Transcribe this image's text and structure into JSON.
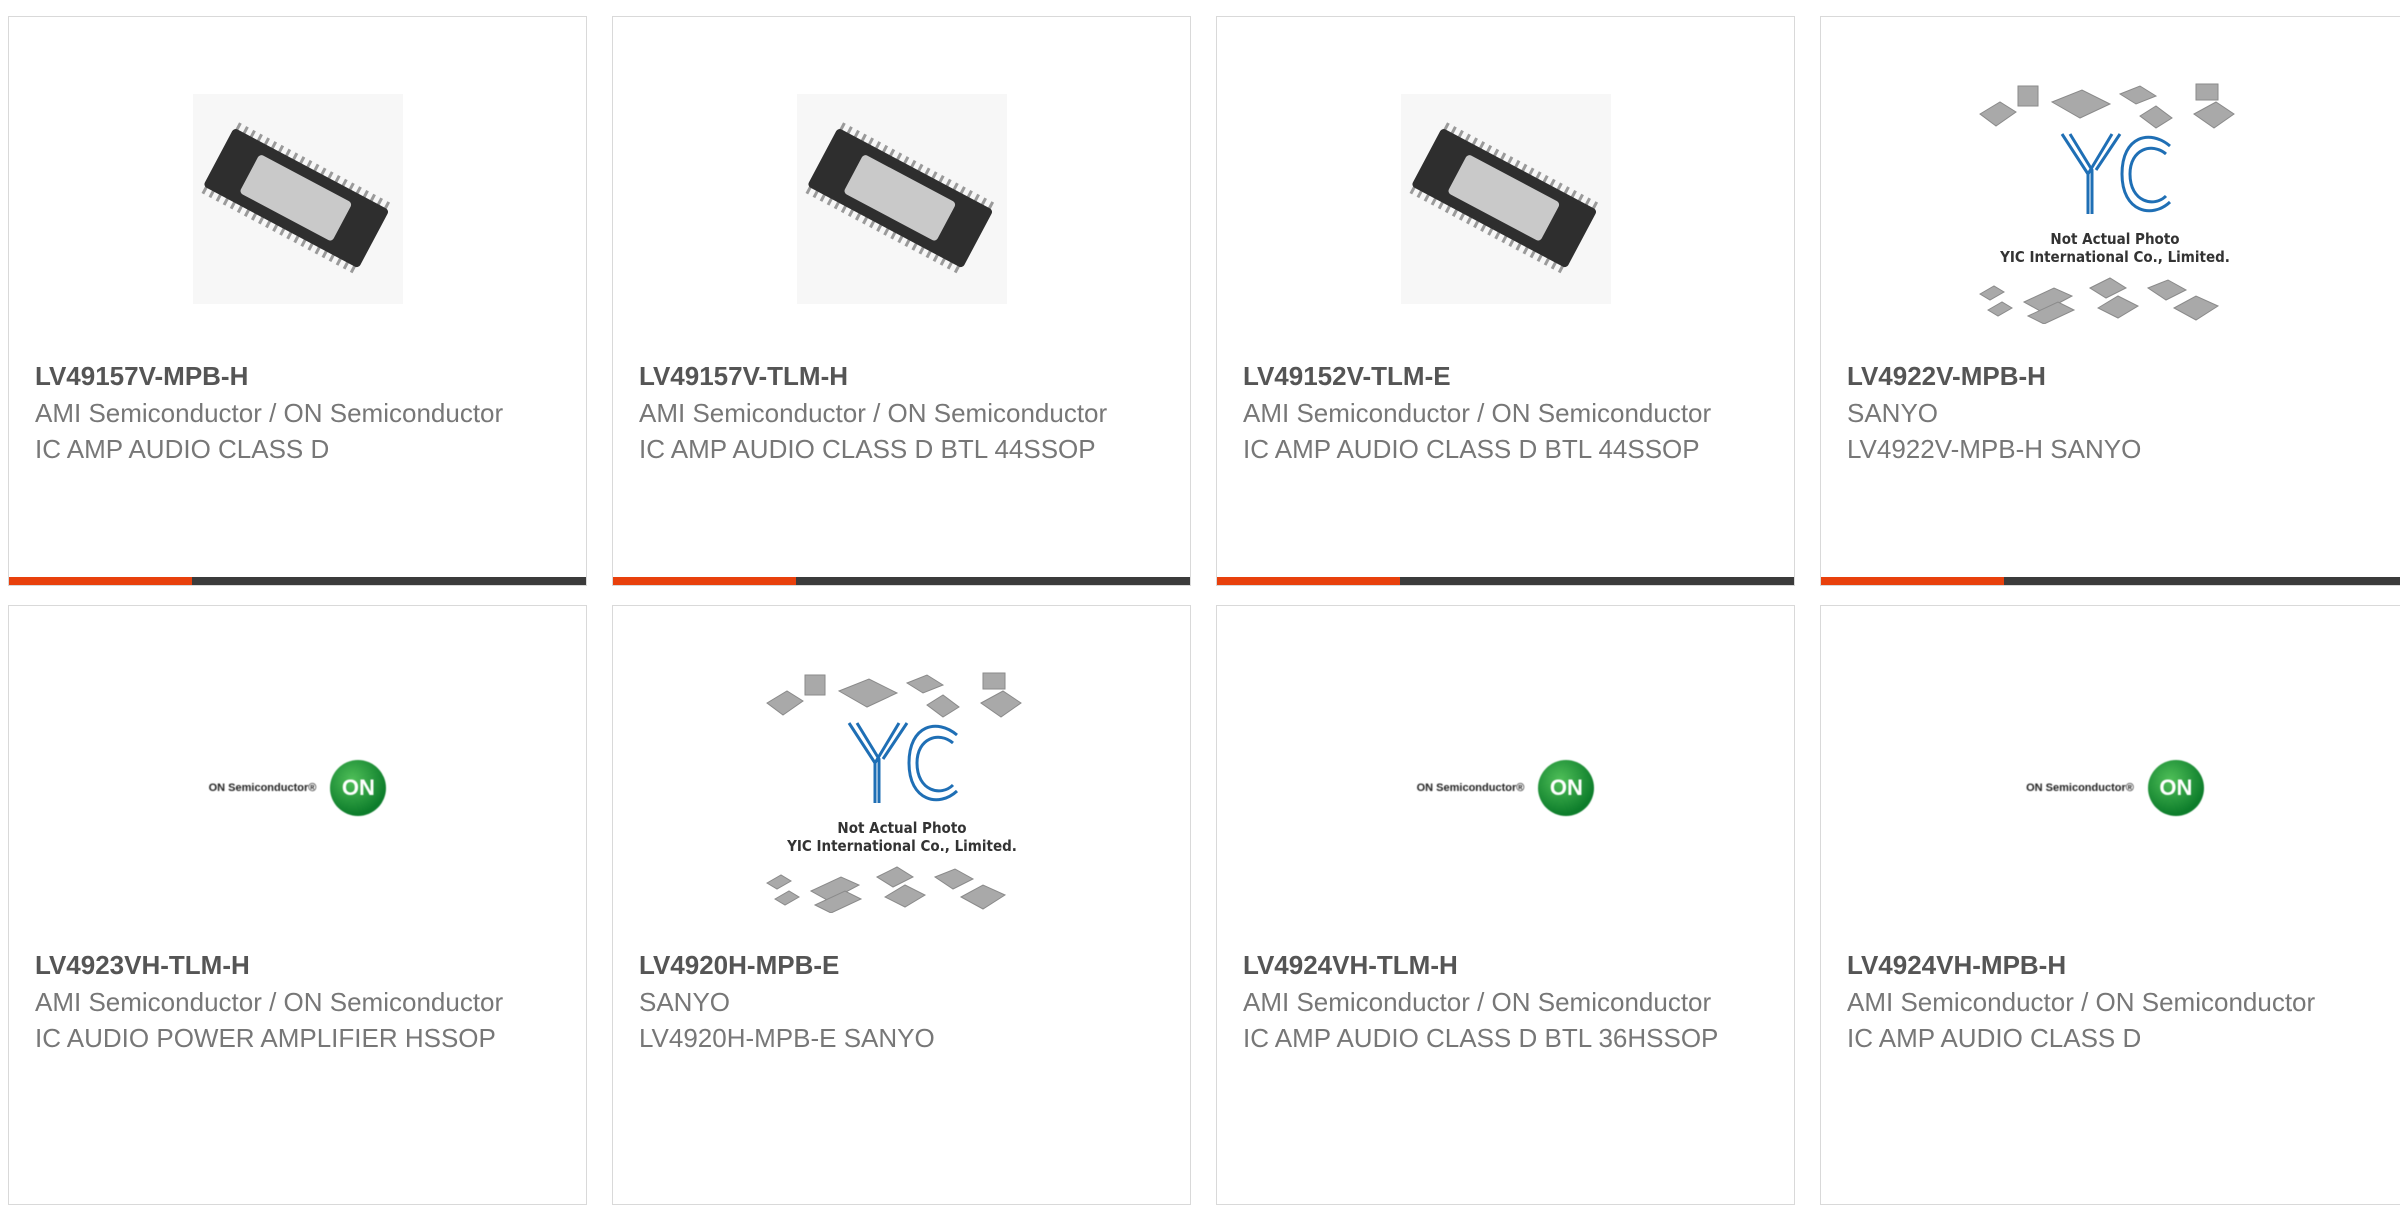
{
  "products": [
    {
      "part_number": "LV49157V-MPB-H",
      "manufacturer": "AMI Semiconductor / ON Semiconductor",
      "description": "IC AMP AUDIO CLASS D",
      "image": "chip-photo"
    },
    {
      "part_number": "LV49157V-TLM-H",
      "manufacturer": "AMI Semiconductor / ON Semiconductor",
      "description": "IC AMP AUDIO CLASS D BTL 44SSOP",
      "image": "chip-photo"
    },
    {
      "part_number": "LV49152V-TLM-E",
      "manufacturer": "AMI Semiconductor / ON Semiconductor",
      "description": "IC AMP AUDIO CLASS D BTL 44SSOP",
      "image": "chip-photo"
    },
    {
      "part_number": "LV4922V-MPB-H",
      "manufacturer": "SANYO",
      "description": "LV4922V-MPB-H SANYO",
      "image": "yic-placeholder"
    },
    {
      "part_number": "LV4923VH-TLM-H",
      "manufacturer": "AMI Semiconductor / ON Semiconductor",
      "description": "IC AUDIO POWER AMPLIFIER HSSOP",
      "image": "on-semi-logo"
    },
    {
      "part_number": "LV4920H-MPB-E",
      "manufacturer": "SANYO",
      "description": "LV4920H-MPB-E SANYO",
      "image": "yic-placeholder"
    },
    {
      "part_number": "LV4924VH-TLM-H",
      "manufacturer": "AMI Semiconductor / ON Semiconductor",
      "description": "IC AMP AUDIO CLASS D BTL 36HSSOP",
      "image": "on-semi-logo"
    },
    {
      "part_number": "LV4924VH-MPB-H",
      "manufacturer": "AMI Semiconductor / ON Semiconductor",
      "description": "IC AMP AUDIO CLASS D",
      "image": "on-semi-logo"
    }
  ],
  "logos": {
    "on_semi_text": "ON Semiconductor®",
    "on_badge": "ON",
    "yic_caption_1": "Not Actual Photo",
    "yic_caption_2": "YIC International Co., Limited."
  },
  "colors": {
    "accent": "#e8400c",
    "bar": "#3b3b3b",
    "on_green": "#1a8f35",
    "yic_blue": "#1f6fb5"
  }
}
